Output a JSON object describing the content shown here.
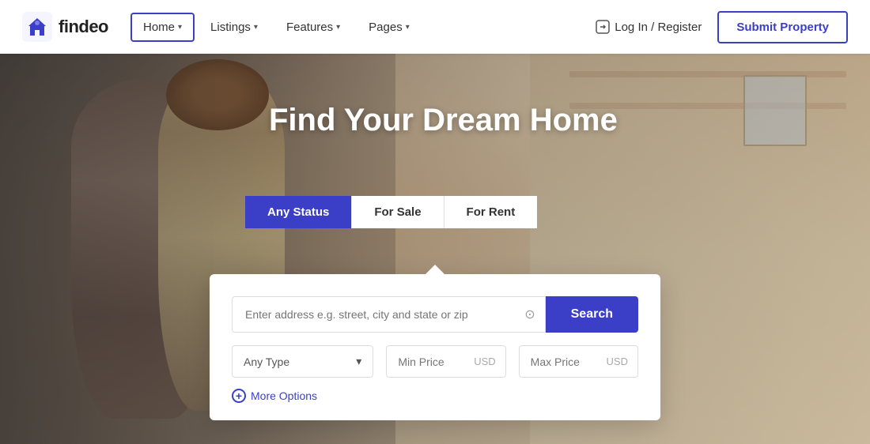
{
  "brand": {
    "name": "findeo"
  },
  "nav": {
    "links": [
      {
        "id": "home",
        "label": "Home",
        "active": true,
        "hasDropdown": true
      },
      {
        "id": "listings",
        "label": "Listings",
        "active": false,
        "hasDropdown": true
      },
      {
        "id": "features",
        "label": "Features",
        "active": false,
        "hasDropdown": true
      },
      {
        "id": "pages",
        "label": "Pages",
        "active": false,
        "hasDropdown": true
      }
    ],
    "login_label": "Log In / Register",
    "submit_label": "Submit Property"
  },
  "hero": {
    "title": "Find Your Dream Home",
    "status_tabs": [
      {
        "id": "any-status",
        "label": "Any Status",
        "active": true
      },
      {
        "id": "for-sale",
        "label": "For Sale",
        "active": false
      },
      {
        "id": "for-rent",
        "label": "For Rent",
        "active": false
      }
    ]
  },
  "search": {
    "address_placeholder": "Enter address e.g. street, city and state or zip",
    "search_label": "Search",
    "type_placeholder": "Any Type",
    "min_price_placeholder": "Min Price",
    "max_price_placeholder": "Max Price",
    "currency_label": "USD",
    "more_options_label": "More Options"
  },
  "colors": {
    "brand_blue": "#3b3fc8",
    "white": "#ffffff",
    "text_dark": "#333333",
    "text_light": "#999999",
    "border": "#dddddd"
  }
}
